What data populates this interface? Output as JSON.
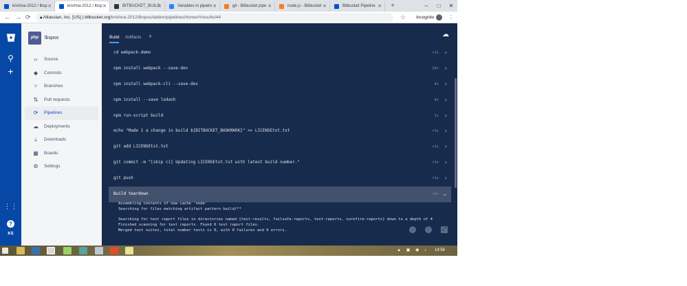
{
  "browser": {
    "tabs": [
      {
        "title": "krishna-2012 / lbsp",
        "active": false,
        "favicon_color": "#0052cc"
      },
      {
        "title": "krishna-2012 / lbsp",
        "active": true,
        "favicon_color": "#0052cc"
      },
      {
        "title": "BITBUCKET_BUILD",
        "active": false,
        "favicon_color": "#333333"
      },
      {
        "title": "Variables in pipelin",
        "active": false,
        "favicon_color": "#2684ff"
      },
      {
        "title": "git - Bitbucket pipe",
        "active": false,
        "favicon_color": "#f48024"
      },
      {
        "title": "node.js - Bitbucket",
        "active": false,
        "favicon_color": "#f48024"
      },
      {
        "title": "Bitbucket Pipeline",
        "active": false,
        "favicon_color": "#0052cc"
      }
    ],
    "new_tab_symbol": "+",
    "window_controls": [
      "–",
      "□",
      "✕"
    ],
    "secure_label": "Atlassian, Inc. [US]",
    "url_host": "bitbucket.org",
    "url_path": "/krishna-2012/lbspos/addon/pipelines/home#!/results/44",
    "incognito_label": "Incognito"
  },
  "global_nav": {
    "search_icon": "⚲",
    "create_icon": "+",
    "apps_icon": "⋮⋮",
    "help_icon": "?",
    "avatar_initials": "KS"
  },
  "sidebar": {
    "repo_logo_text": "php",
    "repo_name": "lbspos",
    "items": [
      {
        "label": "Source",
        "icon": "‹›",
        "active": false
      },
      {
        "label": "Commits",
        "icon": "◆",
        "active": false
      },
      {
        "label": "Branches",
        "icon": "⑂",
        "active": false
      },
      {
        "label": "Pull requests",
        "icon": "⇅",
        "active": false
      },
      {
        "label": "Pipelines",
        "icon": "⟳",
        "active": true
      },
      {
        "label": "Deployments",
        "icon": "☁",
        "active": false
      },
      {
        "label": "Downloads",
        "icon": "⤓",
        "active": false
      },
      {
        "label": "Boards",
        "icon": "▦",
        "active": false
      },
      {
        "label": "Settings",
        "icon": "⚙",
        "active": false
      }
    ]
  },
  "main": {
    "tabs": [
      {
        "label": "Build",
        "active": true
      },
      {
        "label": "Artifacts",
        "active": false
      }
    ],
    "add_tab": "+",
    "steps": [
      {
        "command": "cd webpack-demo",
        "duration": "<1s"
      },
      {
        "command": "npm install webpack --save-dev",
        "duration": "10s"
      },
      {
        "command": "npm install webpack-cli --save-dev",
        "duration": "4s"
      },
      {
        "command": "npm install --save lodash",
        "duration": "4s"
      },
      {
        "command": "npm run-script build",
        "duration": "1s"
      },
      {
        "command": "echo \"Made 1 a change in build ${BITBUCKET_BOOKMARK}\" >> LICENSEtxt.txt",
        "duration": "<1s"
      },
      {
        "command": "git add LICENSEtxt.txt",
        "duration": "<1s"
      },
      {
        "command": "git commit -m \"[skip ci] Updating LICENSEtxt.txt with latest build number.\"",
        "duration": "<1s"
      },
      {
        "command": "git push",
        "duration": "<1s"
      },
      {
        "command": "Build teardown",
        "duration": "<1s",
        "expanded": true
      }
    ],
    "teardown_log": [
      "Assembling contents of new cache 'node'",
      "Searching for files matching artifact pattern build/**",
      "",
      "Searching for test report files in directories named [test-results, failsafe-reports, test-reports, surefire-reports] down to a depth of 4",
      "Finished scanning for test reports. Found 0 test report files.",
      "Merged test suites, total number tests is 0, with 0 failures and 0 errors."
    ]
  },
  "taskbar": {
    "clock": "14:56"
  },
  "colors": {
    "global_nav": "#0747a6",
    "main_bg": "#172b4d",
    "expanded_step": "#42526e",
    "active_link": "#0052cc"
  }
}
